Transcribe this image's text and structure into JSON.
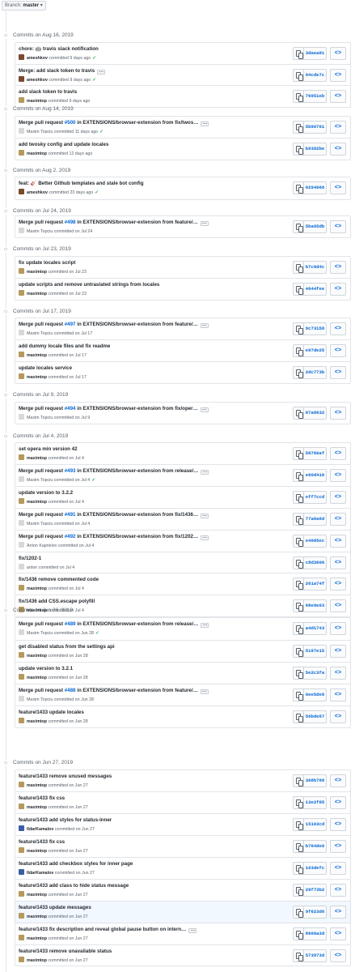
{
  "branch": {
    "prefix": "Branch:",
    "name": "master",
    "caret": "▾"
  },
  "groups": [
    {
      "date": "Commits on Aug 16, 2019",
      "commits": [
        {
          "pre": "chore: 🤖 travis slack notification",
          "author": "ameshkov",
          "verb": "committed",
          "time": "9 days ago",
          "sha": "3daea81",
          "ok": true
        },
        {
          "pre": "Merge: add slack token to travis",
          "ellipsis": true,
          "author": "ameshkov",
          "verb": "committed",
          "time": "9 days ago",
          "sha": "94cde7c",
          "ok": true
        },
        {
          "pre": "add slack token to travis",
          "author": "maximtop",
          "verb": "committed",
          "time": "9 days ago",
          "sha": "76951eb"
        }
      ]
    },
    {
      "date": "Commits on Aug 14, 2019",
      "commits": [
        {
          "pre": "Merge pull request ",
          "link": "#500",
          "post": " in EXTENSIONS/browser-extension from fix/twos…",
          "ellipsis": true,
          "author": "Maxim Topciu",
          "verb": "committed",
          "time": "11 days ago",
          "sha": "5b90701",
          "ok": true,
          "plain": true
        },
        {
          "pre": "add twosky config and update locales",
          "author": "maximtop",
          "verb": "committed",
          "time": "12 days ago",
          "sha": "b9392be"
        }
      ]
    },
    {
      "date": "Commits on Aug 2, 2019",
      "commits": [
        {
          "pre": "feat: 🎸 Better Github templates and stale bot config",
          "author": "ameshkov",
          "verb": "committed",
          "time": "23 days ago",
          "sha": "0294666",
          "ok": true
        }
      ]
    },
    {
      "date": "Commits on Jul 24, 2019",
      "commits": [
        {
          "pre": "Merge pull request ",
          "link": "#498",
          "post": " in EXTENSIONS/browser-extension from feature/…",
          "ellipsis": true,
          "author": "Maxim Topciu",
          "verb": "committed on",
          "time": "Jul 24",
          "sha": "5ba05db",
          "plain": true
        }
      ]
    },
    {
      "date": "Commits on Jul 23, 2019",
      "commits": [
        {
          "pre": "fix update locales script",
          "author": "maximtop",
          "verb": "committed on",
          "time": "Jul 23",
          "sha": "b7c6d4c"
        },
        {
          "pre": "update scripts and remove untraslated strings from locales",
          "author": "maximtop",
          "verb": "committed on",
          "time": "Jul 23",
          "sha": "4644fee"
        }
      ]
    },
    {
      "date": "Commits on Jul 17, 2019",
      "commits": [
        {
          "pre": "Merge pull request ",
          "link": "#497",
          "post": " in EXTENSIONS/browser-extension from feature/…",
          "ellipsis": true,
          "author": "Maxim Topciu",
          "verb": "committed on",
          "time": "Jul 17",
          "sha": "9c73158",
          "plain": true
        },
        {
          "pre": "add dummy locale files and fix readme",
          "author": "maximtop",
          "verb": "committed on",
          "time": "Jul 17",
          "sha": "e97de25"
        },
        {
          "pre": "update locales service",
          "author": "maximtop",
          "verb": "committed on",
          "time": "Jul 17",
          "sha": "2dc773b"
        }
      ]
    },
    {
      "date": "Commits on Jul 9, 2019",
      "commits": [
        {
          "pre": "Merge pull request ",
          "link": "#494",
          "post": " in EXTENSIONS/browser-extension from fix/oper…",
          "ellipsis": true,
          "author": "Maxim Topciu",
          "verb": "committed on",
          "time": "Jul 9",
          "sha": "87a8632",
          "plain": true
        }
      ]
    },
    {
      "date": "Commits on Jul 4, 2019",
      "commits": [
        {
          "pre": "set opera min version 42",
          "author": "maximtop",
          "verb": "committed on",
          "time": "Jul 4",
          "sha": "58760af"
        },
        {
          "pre": "Merge pull request ",
          "link": "#493",
          "post": " in EXTENSIONS/browser-extension from release/…",
          "ellipsis": true,
          "author": "Maxim Topciu",
          "verb": "committed on",
          "time": "Jul 4",
          "sha": "e60d418",
          "ok": true,
          "plain": true
        },
        {
          "pre": "update version to 3.2.2",
          "author": "maximtop",
          "verb": "committed on",
          "time": "Jul 4",
          "sha": "eff7ccd"
        },
        {
          "pre": "Merge pull request ",
          "link": "#491",
          "post": " in EXTENSIONS/browser-extension from fix/1436…",
          "ellipsis": true,
          "author": "Maxim Topciu",
          "verb": "committed on",
          "time": "Jul 4",
          "sha": "77a0a6d",
          "plain": true
        },
        {
          "pre": "Merge pull request ",
          "link": "#492",
          "post": " in EXTENSIONS/browser-extension from fix/1202…",
          "ellipsis": true,
          "author": "Anton Kaprielov",
          "verb": "committed on",
          "time": "Jul 4",
          "sha": "e4085ec",
          "plain": true
        },
        {
          "pre": "fix/1202-1",
          "author": "anton",
          "verb": "committed on",
          "time": "Jul 4",
          "sha": "c8d3606",
          "plain": true
        },
        {
          "pre": "fix/1436 remove commented code",
          "author": "maximtop",
          "verb": "committed on",
          "time": "Jul 4",
          "sha": "261a74f"
        },
        {
          "pre": "fix/1436 add CSS.escape polyfill",
          "author": "maximtop",
          "verb": "committed on",
          "time": "Jul 4",
          "sha": "68e9e03"
        }
      ]
    },
    {
      "date": "Commits on Jun 28, 2019",
      "commits": [
        {
          "pre": "Merge pull request ",
          "link": "#489",
          "post": " in EXTENSIONS/browser-extension from release/…",
          "ellipsis": true,
          "author": "Maxim Topciu",
          "verb": "committed on",
          "time": "Jun 28",
          "sha": "a4d1743",
          "ok": true,
          "plain": true
        },
        {
          "pre": "get disabled status from the settings api",
          "author": "maximtop",
          "verb": "committed on",
          "time": "Jun 28",
          "sha": "5197e15"
        },
        {
          "pre": "update version to 3.2.1",
          "author": "maximtop",
          "verb": "committed on",
          "time": "Jun 28",
          "sha": "5e2c3fa"
        },
        {
          "pre": "Merge pull request ",
          "link": "#488",
          "post": " in EXTENSIONS/browser-extension from feature/…",
          "ellipsis": true,
          "author": "Maxim Topciu",
          "verb": "committed on",
          "time": "Jun 28",
          "sha": "0ee5de6",
          "plain": true
        },
        {
          "pre": "feature/1433 update locales",
          "author": "maximtop",
          "verb": "committed on",
          "time": "Jun 28",
          "sha": "56bde67"
        }
      ]
    },
    {
      "date": "Commits on Jun 27, 2019",
      "commits": [
        {
          "pre": "feature/1433 remove unused messages",
          "author": "maximtop",
          "verb": "committed on",
          "time": "Jun 27",
          "sha": "308b788"
        },
        {
          "pre": "feature/1433 fix css",
          "author": "maximtop",
          "verb": "committed on",
          "time": "Jun 27",
          "sha": "13e2f85"
        },
        {
          "pre": "feature/1433 add styles for status-inner",
          "author": "IldarKamalov",
          "verb": "committed on",
          "time": "Jun 27",
          "sha": "15103cd"
        },
        {
          "pre": "feature/1433 fix css",
          "author": "maximtop",
          "verb": "committed on",
          "time": "Jun 27",
          "sha": "b764de0"
        },
        {
          "pre": "feature/1433 add checkbox styles for inner page",
          "author": "IldarKamalov",
          "verb": "committed on",
          "time": "Jun 27",
          "sha": "103defc"
        },
        {
          "pre": "feature/1433 add class to hide status message",
          "author": "maximtop",
          "verb": "committed on",
          "time": "Jun 27",
          "sha": "29f73b2"
        },
        {
          "pre": "feature/1433 update messages",
          "author": "maximtop",
          "verb": "committed on",
          "time": "Jun 27",
          "sha": "9f623d0",
          "hl": true
        },
        {
          "pre": "feature/1433 fix description and reveal global pause button on intern…",
          "ellipsis": true,
          "author": "maximtop",
          "verb": "committed on",
          "time": "Jun 27",
          "sha": "8600a3d"
        },
        {
          "pre": "feature/1433 remove unavailable status",
          "author": "maximtop",
          "verb": "committed on",
          "time": "Jun 27",
          "sha": "573973d"
        }
      ]
    }
  ],
  "icons": {
    "history": "○",
    "copy": "clipboard-icon",
    "browse": "<>"
  },
  "colors": {
    "link": "#0366d6",
    "check": "#28a745",
    "border": "#e1e4e8",
    "highlight": "#f1f8ff"
  }
}
